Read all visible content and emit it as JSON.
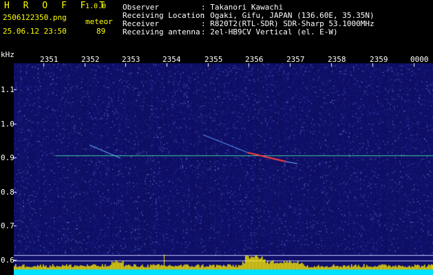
{
  "header": {
    "app_title": "H R O F F T",
    "app_version": "1.0.0",
    "filename": "2506122350.png",
    "category": "meteor",
    "datetime": "25.06.12 23:50",
    "count": "89",
    "observer_label": "Observer",
    "observer_value": ": Takanori Kawachi",
    "location_label": "Receiving Location",
    "location_value": ": Ogaki, Gifu, JAPAN (136.60E, 35.35N)",
    "receiver_label": "Receiver",
    "receiver_value": ": R820T2(RTL-SDR) SDR-Sharp 53.1000MHz",
    "antenna_label": "Receiving antenna",
    "antenna_value": ": 2el-HB9CV Vertical (el. E-W)"
  },
  "spectrogram": {
    "y_unit": "kHz",
    "x_ticks": [
      "2351",
      "2352",
      "2353",
      "2354",
      "2355",
      "2356",
      "2357",
      "2358",
      "2359",
      "0000"
    ],
    "y_ticks": [
      "1.1",
      "1.0",
      "0.9",
      "0.8",
      "0.7",
      "0.6"
    ],
    "colors": {
      "background": "#10106a",
      "carrier": "#40e0a0",
      "trace": "#ff4040",
      "baseline": "#00e0ff",
      "peaks": "#ffee00"
    }
  }
}
